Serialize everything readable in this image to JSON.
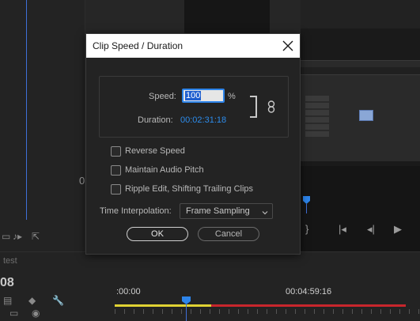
{
  "dialog": {
    "title": "Clip Speed / Duration",
    "speed_label": "Speed:",
    "speed_value": "100",
    "speed_unit": "%",
    "duration_label": "Duration:",
    "duration_value": "00:02:31:18",
    "checkboxes": [
      {
        "label": "Reverse Speed",
        "checked": false
      },
      {
        "label": "Maintain Audio Pitch",
        "checked": false
      },
      {
        "label": "Ripple Edit, Shifting Trailing Clips",
        "checked": false
      }
    ],
    "time_interpolation_label": "Time Interpolation:",
    "time_interpolation_value": "Frame Sampling",
    "ok_label": "OK",
    "cancel_label": "Cancel"
  },
  "background": {
    "left_zero": "0",
    "timeline_name": "test",
    "timeline_timecode": "08",
    "ruler_start": ":00:00",
    "ruler_end": "00:04:59:16"
  },
  "colors": {
    "accent": "#2d84ea",
    "in_out_yellow": "#e0d233",
    "render_red": "#c8262c"
  }
}
